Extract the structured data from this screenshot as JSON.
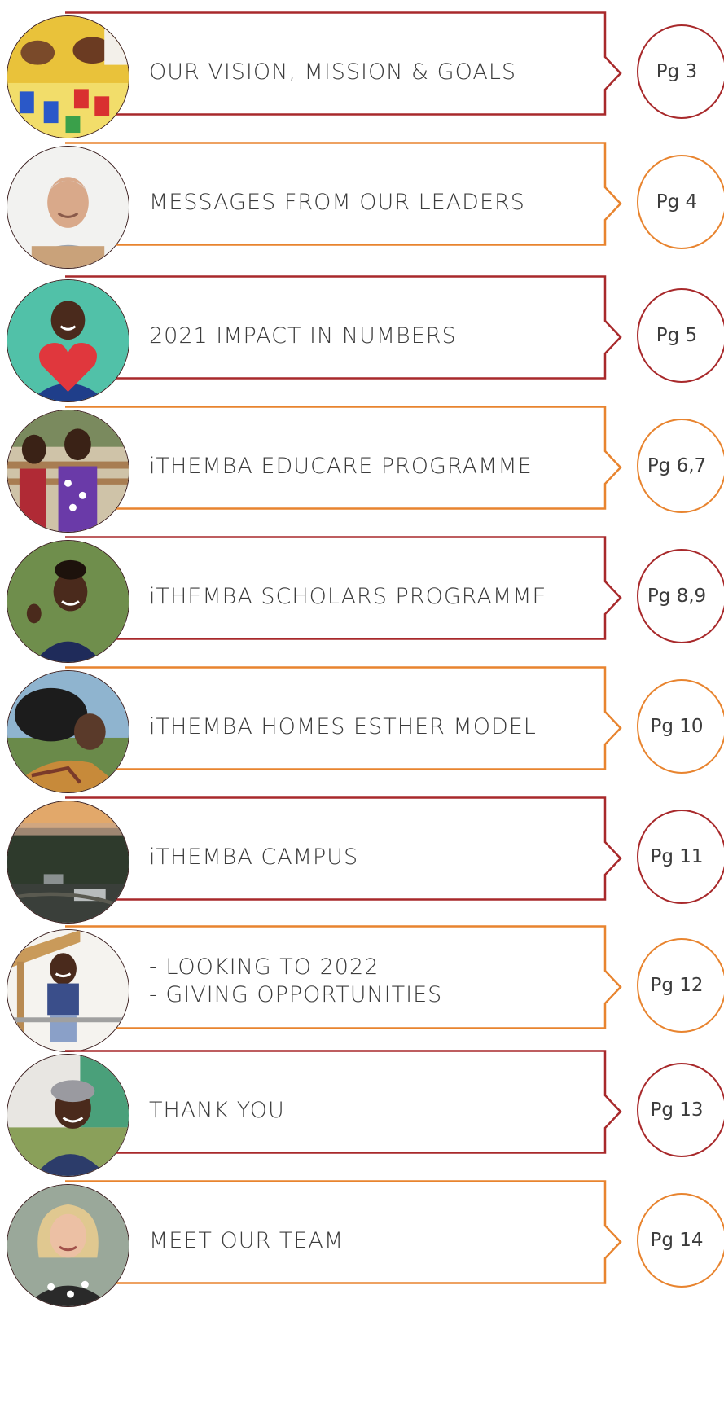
{
  "colors": {
    "red": "#a8292b",
    "orange": "#e8842f",
    "text": "#3c3c3c"
  },
  "entries": [
    {
      "lines": [
        "OUR VISION, MISSION & GOALS"
      ],
      "page": "Pg 3",
      "color": "red",
      "photo": "children-building-blocks-photo"
    },
    {
      "lines": [
        "MESSAGES FROM OUR LEADERS"
      ],
      "page": "Pg 4",
      "color": "orange",
      "photo": "smiling-elderly-man-photo"
    },
    {
      "lines": [
        "2021 IMPACT IN NUMBERS"
      ],
      "page": "Pg 5",
      "color": "red",
      "photo": "boy-holding-heart-photo"
    },
    {
      "lines": [
        "iTHEMBA EDUCARE PROGRAMME"
      ],
      "page": "Pg 6,7",
      "color": "orange",
      "photo": "children-on-playground-photo"
    },
    {
      "lines": [
        "iTHEMBA SCHOLARS PROGRAMME"
      ],
      "page": "Pg 8,9",
      "color": "red",
      "photo": "girl-waving-photo"
    },
    {
      "lines": [
        "iTHEMBA HOMES ESTHER MODEL"
      ],
      "page": "Pg 10",
      "color": "orange",
      "photo": "mother-and-child-photo"
    },
    {
      "lines": [
        "iTHEMBA CAMPUS"
      ],
      "page": "Pg 11",
      "color": "red",
      "photo": "aerial-campus-photo"
    },
    {
      "lines": [
        "- LOOKING TO 2022",
        "- GIVING OPPORTUNITIES"
      ],
      "page": "Pg 12",
      "color": "orange",
      "photo": "boy-on-climbing-frame-photo"
    },
    {
      "lines": [
        "THANK YOU"
      ],
      "page": "Pg 13",
      "color": "red",
      "photo": "boy-in-cap-photo"
    },
    {
      "lines": [
        "MEET OUR TEAM"
      ],
      "page": "Pg 14",
      "color": "orange",
      "photo": "smiling-woman-photo"
    }
  ]
}
